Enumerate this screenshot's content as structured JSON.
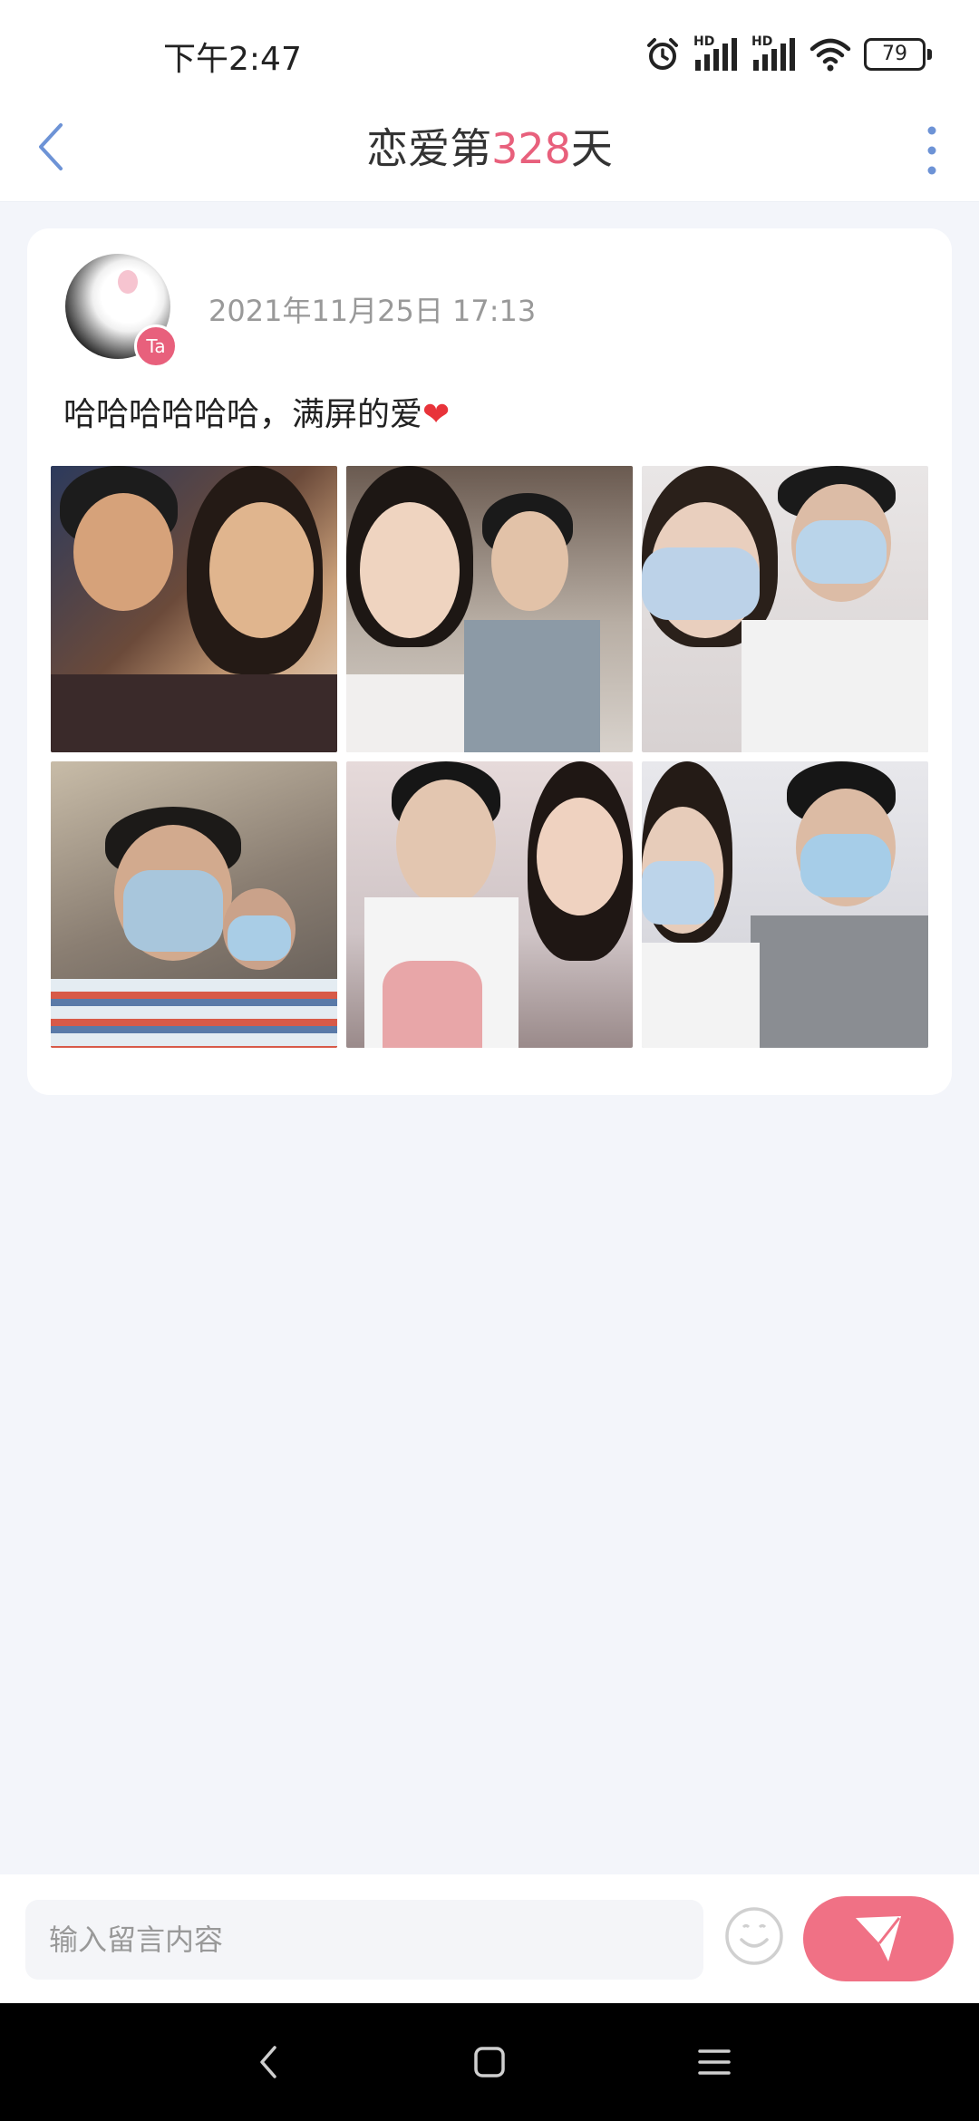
{
  "status_bar": {
    "time": "下午2:47",
    "signal_label_1": "HD",
    "signal_label_2": "HD",
    "battery": "79"
  },
  "header": {
    "title_prefix": "恋爱第",
    "title_number": "328",
    "title_suffix": "天",
    "accent_color": "#e8607c"
  },
  "post": {
    "badge": "Ta",
    "date": "2021年11月25日 17:13",
    "text": "哈哈哈哈哈哈，满屏的爱",
    "emoji": "❤",
    "photos": [
      {
        "name": "photo-1"
      },
      {
        "name": "photo-2"
      },
      {
        "name": "photo-3"
      },
      {
        "name": "photo-4"
      },
      {
        "name": "photo-5"
      },
      {
        "name": "photo-6"
      }
    ]
  },
  "comment_bar": {
    "placeholder": "输入留言内容",
    "send_color": "#f07185"
  },
  "icons": {
    "back": "chevron-left-icon",
    "more": "more-vertical-icon",
    "emoji": "smiley-icon",
    "send": "send-icon",
    "nav_back": "nav-back-icon",
    "nav_home": "nav-home-icon",
    "nav_menu": "nav-menu-icon"
  }
}
